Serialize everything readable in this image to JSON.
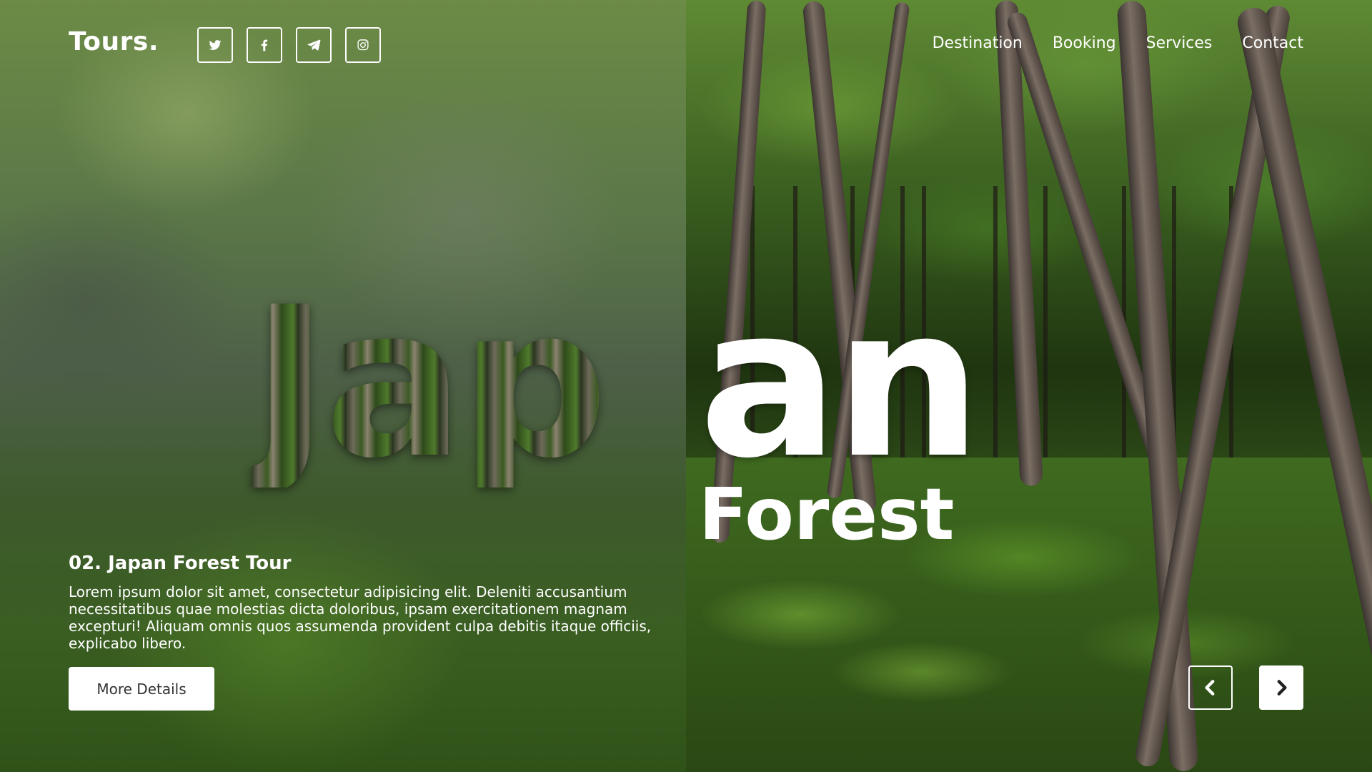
{
  "brand": {
    "logo": "Tours."
  },
  "social": [
    {
      "name": "twitter-icon"
    },
    {
      "name": "facebook-icon"
    },
    {
      "name": "telegram-icon"
    },
    {
      "name": "instagram-icon"
    }
  ],
  "nav": {
    "items": [
      "Destination",
      "Booking",
      "Services",
      "Contact"
    ]
  },
  "hero": {
    "word_part_1": "Jap",
    "word_part_2": "an",
    "word_line_2": "Forest"
  },
  "tour": {
    "title": "02. Japan Forest Tour",
    "description": "Lorem ipsum dolor sit amet, consectetur adipisicing elit. Deleniti accusantium necessitatibus quae molestias dicta doloribus, ipsam exercitationem magnam excepturi! Aliquam omnis quos assumenda provident culpa debitis itaque officiis, explicabo libero.",
    "button_label": "More Details"
  },
  "slider": {
    "prev_icon": "chevron-left-icon",
    "next_icon": "chevron-right-icon"
  },
  "colors": {
    "text": "#ffffff",
    "button_bg": "#ffffff",
    "button_text": "#333333"
  }
}
